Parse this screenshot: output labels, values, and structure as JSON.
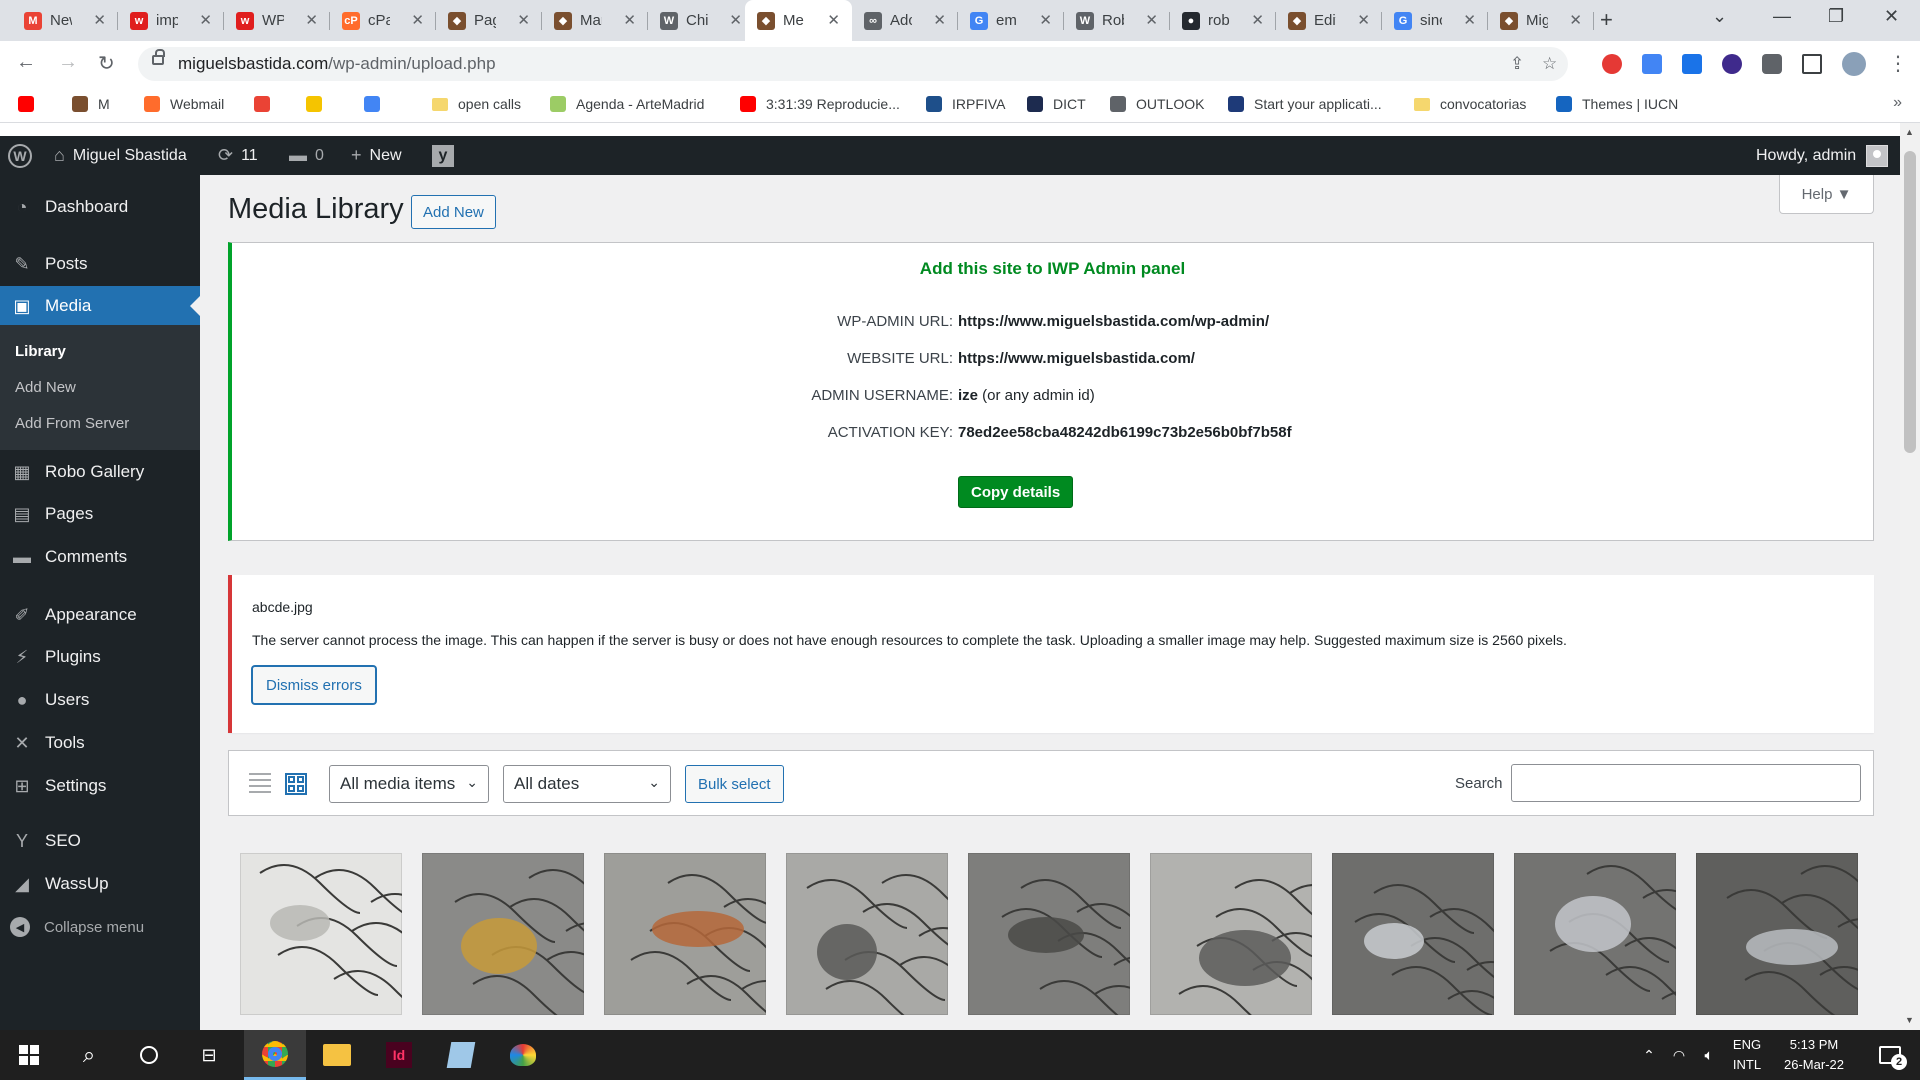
{
  "browser": {
    "tabs": [
      {
        "favicon": "gmail-icon",
        "title": "New",
        "color": "#ea4335",
        "glyph": "M"
      },
      {
        "favicon": "wpengine-icon",
        "title": "imp",
        "color": "#e01e1e",
        "glyph": "w"
      },
      {
        "favicon": "wpengine-icon",
        "title": "WP",
        "color": "#e01e1e",
        "glyph": "w"
      },
      {
        "favicon": "cpanel-icon",
        "title": "cPa",
        "color": "#ff6c2c",
        "glyph": "cP"
      },
      {
        "favicon": "cube-icon",
        "title": "Pag",
        "color": "#7a4f2f",
        "glyph": "◆"
      },
      {
        "favicon": "cube-icon",
        "title": "Mar",
        "color": "#7a4f2f",
        "glyph": "◆"
      },
      {
        "favicon": "wordpress-icon",
        "title": "Chil",
        "color": "#5f6368",
        "glyph": "W"
      },
      {
        "favicon": "cube-icon",
        "title": "Me",
        "color": "#7a4f2f",
        "glyph": "◆"
      },
      {
        "favicon": "infinity-icon",
        "title": "Adc",
        "color": "#5f6368",
        "glyph": "∞"
      },
      {
        "favicon": "google-icon",
        "title": "em",
        "color": "#4285f4",
        "glyph": "G"
      },
      {
        "favicon": "wordpress-icon",
        "title": "Rob",
        "color": "#5f6368",
        "glyph": "W"
      },
      {
        "favicon": "github-icon",
        "title": "rob",
        "color": "#24292f",
        "glyph": "●"
      },
      {
        "favicon": "cube-icon",
        "title": "Edit",
        "color": "#7a4f2f",
        "glyph": "◆"
      },
      {
        "favicon": "google-icon",
        "title": "sinc",
        "color": "#4285f4",
        "glyph": "G"
      },
      {
        "favicon": "cube-icon",
        "title": "Mig",
        "color": "#7a4f2f",
        "glyph": "◆"
      }
    ],
    "active_tab": 7,
    "url_host": "miguelsbastida.com",
    "url_path": "/wp-admin/upload.php",
    "bookmarks": [
      {
        "icon": "youtube-icon",
        "label": "",
        "color": "#ff0000"
      },
      {
        "icon": "cube-icon",
        "label": "M",
        "color": "#7a4f2f"
      },
      {
        "icon": "cpanel-icon",
        "label": "Webmail",
        "color": "#ff6c2c"
      },
      {
        "icon": "gmail-icon",
        "label": "",
        "color": "#ea4335"
      },
      {
        "icon": "coin-icon",
        "label": "",
        "color": "#f5c400"
      },
      {
        "icon": "google-icon",
        "label": "",
        "color": "#4285f4"
      },
      {
        "icon": "folder-icon",
        "label": "open calls",
        "color": "#f5d76e"
      },
      {
        "icon": "page-icon",
        "label": "Agenda - ArteMadrid",
        "color": "#9ccc65"
      },
      {
        "icon": "youtube-icon",
        "label": "3:31:39 Reproducie...",
        "color": "#ff0000"
      },
      {
        "icon": "ds-icon",
        "label": "IRPFIVA",
        "color": "#1e4f8a"
      },
      {
        "icon": "shield-icon",
        "label": "DICT",
        "color": "#1d2b4f"
      },
      {
        "icon": "globe-icon",
        "label": "OUTLOOK",
        "color": "#5f6368"
      },
      {
        "icon": "ucsc-icon",
        "label": "Start your applicati...",
        "color": "#1e3a78"
      },
      {
        "icon": "folder-icon",
        "label": "convocatorias",
        "color": "#f5d76e"
      },
      {
        "icon": "iucn-icon",
        "label": "Themes | IUCN",
        "color": "#1565c0"
      }
    ]
  },
  "adminbar": {
    "site_name": "Miguel Sbastida",
    "updates_count": "11",
    "comments_count": "0",
    "new_label": "New",
    "howdy": "Howdy, admin"
  },
  "sidebar": {
    "items": [
      {
        "key": "dashboard",
        "label": "Dashboard",
        "icon": "dashboard-icon",
        "glyph": "◔"
      },
      {
        "key": "posts",
        "label": "Posts",
        "icon": "pin-icon",
        "glyph": "✎"
      },
      {
        "key": "media",
        "label": "Media",
        "icon": "media-icon",
        "glyph": "▣"
      },
      {
        "key": "robo-gallery",
        "label": "Robo Gallery",
        "icon": "gallery-icon",
        "glyph": "▦"
      },
      {
        "key": "pages",
        "label": "Pages",
        "icon": "pages-icon",
        "glyph": "▤"
      },
      {
        "key": "comments",
        "label": "Comments",
        "icon": "comment-icon",
        "glyph": "▬"
      },
      {
        "key": "appearance",
        "label": "Appearance",
        "icon": "brush-icon",
        "glyph": "✐"
      },
      {
        "key": "plugins",
        "label": "Plugins",
        "icon": "plug-icon",
        "glyph": "⚡"
      },
      {
        "key": "users",
        "label": "Users",
        "icon": "user-icon",
        "glyph": "●"
      },
      {
        "key": "tools",
        "label": "Tools",
        "icon": "wrench-icon",
        "glyph": "✕"
      },
      {
        "key": "settings",
        "label": "Settings",
        "icon": "settings-icon",
        "glyph": "⊞"
      },
      {
        "key": "seo",
        "label": "SEO",
        "icon": "yoast-icon",
        "glyph": "Y"
      },
      {
        "key": "wassup",
        "label": "WassUp",
        "icon": "chart-icon",
        "glyph": "◢"
      }
    ],
    "submenu": [
      "Library",
      "Add New",
      "Add From Server"
    ],
    "collapse_label": "Collapse menu"
  },
  "main": {
    "title": "Media Library",
    "add_new_label": "Add New",
    "help_label": "Help ▼",
    "iwp": {
      "title": "Add this site to IWP Admin panel",
      "rows": [
        {
          "label": "WP-ADMIN URL:",
          "value": "https://www.miguelsbastida.com/wp-admin/",
          "bold": true,
          "suffix": ""
        },
        {
          "label": "WEBSITE URL:",
          "value": "https://www.miguelsbastida.com/",
          "bold": true,
          "suffix": ""
        },
        {
          "label": "ADMIN USERNAME:",
          "value": "ize",
          "bold": true,
          "suffix": " (or any admin id)"
        },
        {
          "label": "ACTIVATION KEY:",
          "value": "78ed2ee58cba48242db6199c73b2e56b0bf7b58f",
          "bold": true,
          "suffix": ""
        }
      ],
      "copy_label": "Copy details"
    },
    "error": {
      "filename": "abcde.jpg",
      "message": "The server cannot process the image. This can happen if the server is busy or does not have enough resources to complete the task. Uploading a smaller image may help. Suggested maximum size is 2560 pixels.",
      "dismiss_label": "Dismiss errors"
    },
    "filters": {
      "type_selected": "All media items",
      "date_selected": "All dates",
      "bulk_label": "Bulk select",
      "search_label": "Search",
      "search_value": ""
    },
    "thumbnails": [
      {
        "alt": "wire sculpture on white",
        "bg": "#e4e4e2",
        "accent": "#b8b8b4"
      },
      {
        "alt": "wire sculpture with wood",
        "bg": "#8a8a88",
        "accent": "#c79a3a"
      },
      {
        "alt": "copper leaf sculpture",
        "bg": "#9e9e9a",
        "accent": "#b5673a"
      },
      {
        "alt": "wire frame sculpture",
        "bg": "#a9a9a6",
        "accent": "#5a5a58"
      },
      {
        "alt": "wire bird sculpture",
        "bg": "#7e7e7c",
        "accent": "#4a4a48"
      },
      {
        "alt": "wire fish sculpture",
        "bg": "#b2b2af",
        "accent": "#5c5c5a"
      },
      {
        "alt": "metal leaves sculpture",
        "bg": "#6e6e6c",
        "accent": "#c9ccd0"
      },
      {
        "alt": "metal leaves close-up",
        "bg": "#737371",
        "accent": "#c3c6ca"
      },
      {
        "alt": "metal leaves on wire",
        "bg": "#5f5f5d",
        "accent": "#b8bcc0"
      }
    ]
  },
  "taskbar": {
    "lang1": "ENG",
    "lang2": "INTL",
    "time": "5:13 PM",
    "date": "26-Mar-22",
    "notif_count": "2"
  }
}
